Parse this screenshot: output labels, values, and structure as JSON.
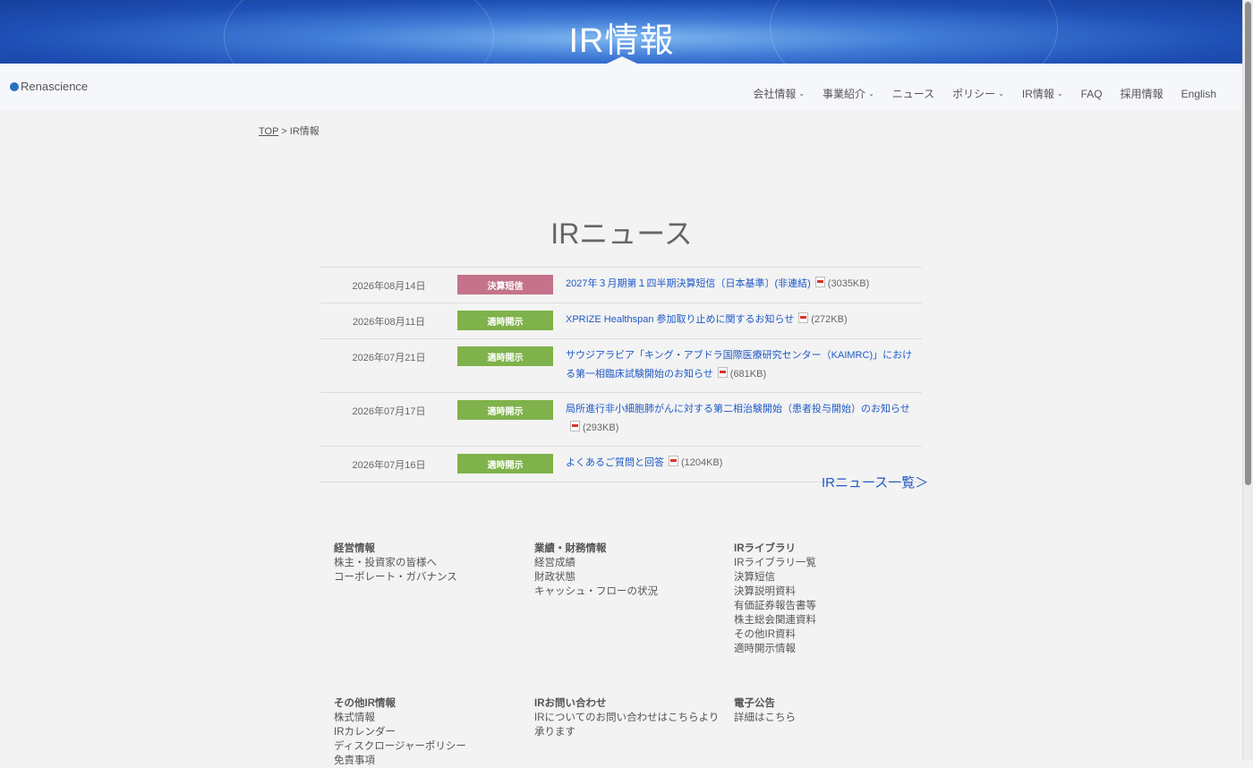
{
  "hero": {
    "title": "IR情報"
  },
  "logo": {
    "text": "Renascience"
  },
  "nav": [
    {
      "label": "会社情報",
      "caret": true
    },
    {
      "label": "事業紹介",
      "caret": true
    },
    {
      "label": "ニュース",
      "caret": false
    },
    {
      "label": "ポリシー",
      "caret": true
    },
    {
      "label": "IR情報",
      "caret": true
    },
    {
      "label": "FAQ",
      "caret": false
    },
    {
      "label": "採用情報",
      "caret": false
    },
    {
      "label": "English",
      "caret": false
    }
  ],
  "breadcrumb": {
    "top": "TOP",
    "separator": " > ",
    "current": "IR情報"
  },
  "section_title": "IRニュース",
  "news": [
    {
      "date": "2026年08月14日",
      "badge": "決算短信",
      "badge_color": "#c4738b",
      "title": "2027年３月期第１四半期決算短信〔日本基準〕(非連結)",
      "size": "(3035KB)"
    },
    {
      "date": "2026年08月11日",
      "badge": "適時開示",
      "badge_color": "#7fb24a",
      "title": "XPRIZE Healthspan 参加取り止めに関するお知らせ",
      "size": "(272KB)"
    },
    {
      "date": "2026年07月21日",
      "badge": "適時開示",
      "badge_color": "#7fb24a",
      "title": "サウジアラビア「キング・アブドラ国際医療研究センター（KAIMRC)」における第一相臨床試験開始のお知らせ",
      "size": "(681KB)"
    },
    {
      "date": "2026年07月17日",
      "badge": "適時開示",
      "badge_color": "#7fb24a",
      "title": "局所進行非小細胞肺がんに対する第二相治験開始（患者投与開始）のお知らせ",
      "size": "(293KB)"
    },
    {
      "date": "2026年07月16日",
      "badge": "適時開示",
      "badge_color": "#7fb24a",
      "title": "よくあるご質問と回答",
      "size": "(1204KB)"
    }
  ],
  "more_link": "IRニュース一覧＞",
  "footer_links": [
    {
      "heading": "経営情報",
      "items": [
        "株主・投資家の皆様へ",
        "コーポレート・ガバナンス"
      ]
    },
    {
      "heading": "業績・財務情報",
      "items": [
        "経営成績",
        "財政状態",
        "キャッシュ・フローの状況"
      ]
    },
    {
      "heading": "IRライブラリ",
      "items": [
        "IRライブラリ一覧",
        "決算短信",
        "決算説明資料",
        "有価証券報告書等",
        "株主総会関連資料",
        "その他IR資料",
        "適時開示情報"
      ]
    },
    {
      "heading": "その他IR情報",
      "items": [
        "株式情報",
        "IRカレンダー",
        "ディスクロージャーポリシー",
        "免責事項"
      ]
    },
    {
      "heading": "IRお問い合わせ",
      "items": [
        "IRについてのお問い合わせはこちらより承ります"
      ]
    },
    {
      "heading": "電子公告",
      "items": [
        "詳細はこちら"
      ]
    }
  ]
}
